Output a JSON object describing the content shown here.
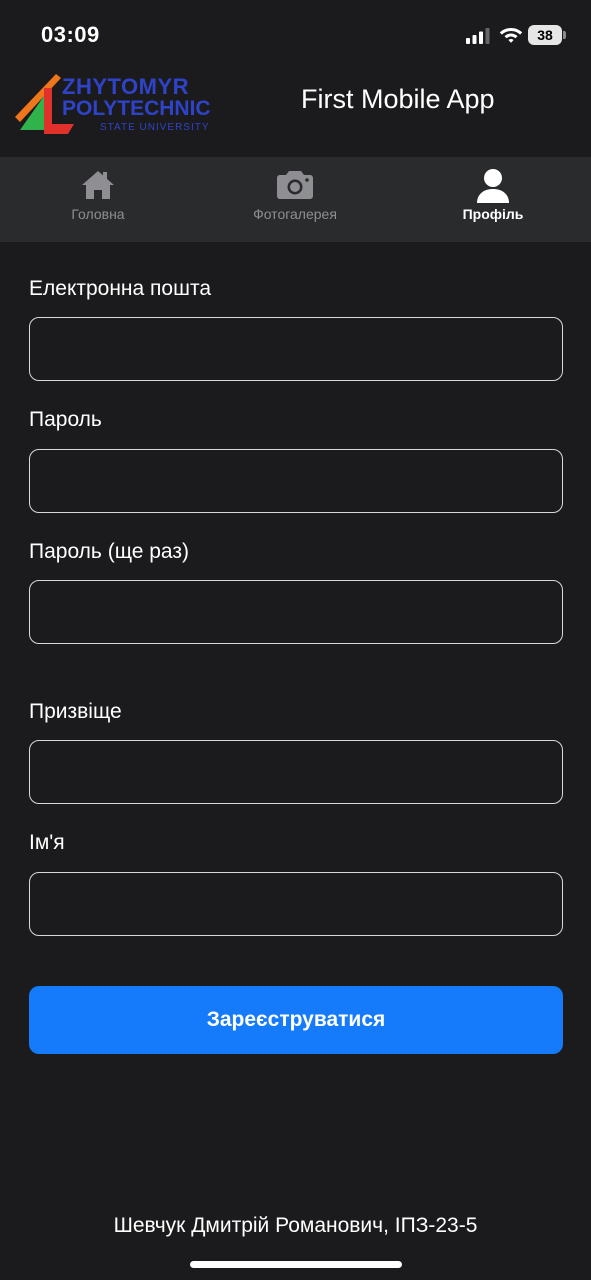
{
  "status_bar": {
    "time": "03:09",
    "battery": "38",
    "icons": [
      "cellular-signal-icon",
      "wifi-icon",
      "battery-icon"
    ]
  },
  "header": {
    "logo": {
      "line1": "ZHYTOMYR",
      "line2": "POLYTECHNIC",
      "line3": "STATE UNIVERSITY"
    },
    "title": "First Mobile App"
  },
  "tabs": [
    {
      "label": "Головна",
      "icon": "home-icon",
      "active": false
    },
    {
      "label": "Фотогалерея",
      "icon": "camera-icon",
      "active": false
    },
    {
      "label": "Профіль",
      "icon": "person-icon",
      "active": true
    }
  ],
  "form": {
    "email_label": "Електронна пошта",
    "email_value": "",
    "password_label": "Пароль",
    "password_value": "",
    "password_repeat_label": "Пароль (ще раз)",
    "password_repeat_value": "",
    "surname_label": "Призвіще",
    "surname_value": "",
    "name_label": "Ім'я",
    "name_value": "",
    "submit_label": "Зареєструватися"
  },
  "footer": {
    "author": "Шевчук Дмитрій Романович, ІПЗ-23-5"
  },
  "colors": {
    "background": "#1b1b1d",
    "tabbar": "#2a2b2c",
    "accent": "#157bfa",
    "logo_blue": "#2f43c9",
    "logo_orange": "#f0761c",
    "logo_green": "#2fb34a",
    "logo_red": "#e0312b"
  }
}
